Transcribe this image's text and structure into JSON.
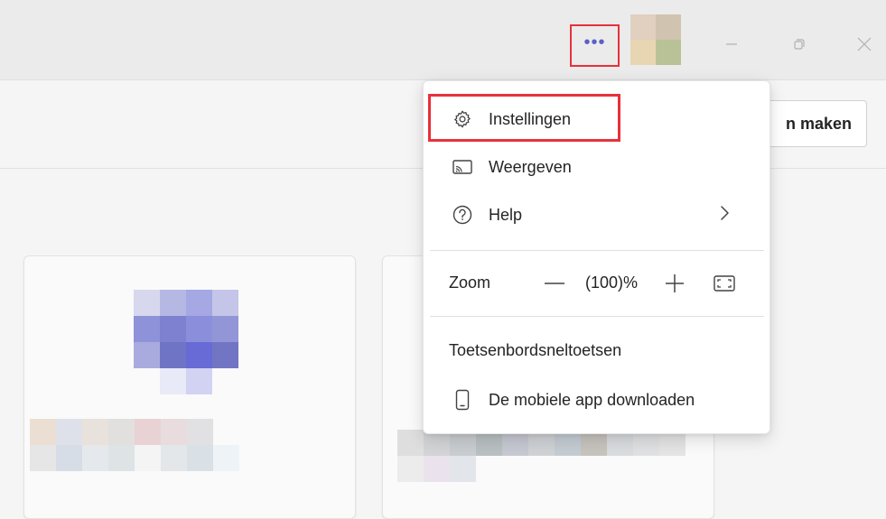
{
  "titlebar": {
    "more_icon": "more-horizontal-icon",
    "more_glyph": "•••",
    "avatar_icon": "user-avatar",
    "minimize_icon": "minimize-icon",
    "restore_icon": "restore-icon",
    "close_icon": "close-icon"
  },
  "header": {
    "create_button_label": "n maken"
  },
  "menu": {
    "settings": {
      "label": "Instellingen",
      "icon": "gear-icon"
    },
    "view": {
      "label": "Weergeven",
      "icon": "cast-icon"
    },
    "help": {
      "label": "Help",
      "icon": "question-circle-icon",
      "submenu_icon": "chevron-right-icon"
    },
    "zoom": {
      "label": "Zoom",
      "value": "(100)%",
      "minus_icon": "zoom-out-icon",
      "plus_icon": "zoom-in-icon",
      "fit_icon": "fit-screen-icon"
    },
    "keyboard_shortcuts": {
      "label": "Toetsenbordsneltoetsen"
    },
    "mobile_app": {
      "label": "De mobiele app downloaden",
      "icon": "phone-icon"
    }
  },
  "colors": {
    "accent": "#5b5fc7",
    "highlight_border": "#e8313a"
  }
}
